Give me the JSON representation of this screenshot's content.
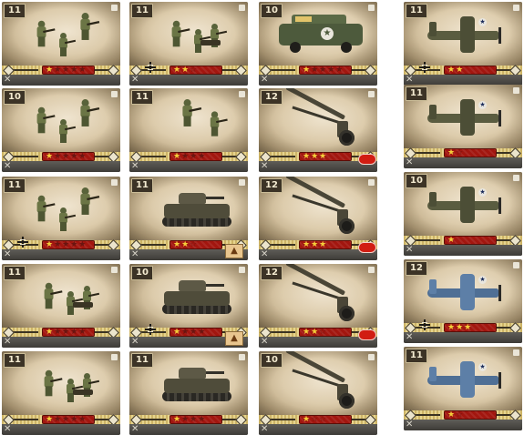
{
  "colors": {
    "ribbon": "#a2160f",
    "star_on": "#f4cf39",
    "star_off": "#6a1510",
    "bar_gold": "#d9c57a",
    "level_bg": "#3c3326",
    "olive_uniform": "#6b7545",
    "navy_plane": "#4f6f95"
  },
  "columns": [
    {
      "cards": [
        {
          "level": "11",
          "unit": "infantry-squad",
          "stars": "★",
          "stars_off": "★★★★",
          "cross": false,
          "badge": "none"
        },
        {
          "level": "10",
          "unit": "infantry-squad",
          "stars": "★",
          "stars_off": "★★★★",
          "cross": false,
          "badge": "none"
        },
        {
          "level": "11",
          "unit": "infantry-squad",
          "stars": "★",
          "stars_off": "★★★★",
          "cross": true,
          "badge": "none"
        },
        {
          "level": "11",
          "unit": "machine-gun-team",
          "stars": "★",
          "stars_off": "★★★★",
          "cross": false,
          "badge": "none"
        },
        {
          "level": "11",
          "unit": "machine-gun-team",
          "stars": "★",
          "stars_off": "★★★★",
          "cross": false,
          "badge": "none"
        }
      ]
    },
    {
      "cards": [
        {
          "level": "11",
          "unit": "machine-gun-team",
          "stars": "★★",
          "stars_off": "☆",
          "cross": true,
          "badge": "none"
        },
        {
          "level": "11",
          "unit": "infantry-pair",
          "stars": "★",
          "stars_off": "★★★",
          "cross": false,
          "badge": "none"
        },
        {
          "level": "11",
          "unit": "light-tank",
          "stars": "★★",
          "stars_off": "☆",
          "cross": false,
          "badge": "triangle"
        },
        {
          "level": "10",
          "unit": "light-tank",
          "stars": "★",
          "stars_off": "★★★",
          "cross": true,
          "badge": "triangle"
        },
        {
          "level": "11",
          "unit": "light-tank",
          "stars": "★",
          "stars_off": "★★★",
          "cross": false,
          "badge": "none"
        }
      ]
    },
    {
      "cards": [
        {
          "level": "10",
          "unit": "armored-car",
          "stars": "★",
          "stars_off": "★★★★",
          "cross": false,
          "badge": "none"
        },
        {
          "level": "12",
          "unit": "howitzer",
          "stars": "★★★",
          "stars_off": "",
          "cross": false,
          "badge": "red"
        },
        {
          "level": "12",
          "unit": "howitzer",
          "stars": "★★★",
          "stars_off": "",
          "cross": false,
          "badge": "red"
        },
        {
          "level": "12",
          "unit": "howitzer",
          "stars": "★★",
          "stars_off": "☆",
          "cross": false,
          "badge": "red"
        },
        {
          "level": "10",
          "unit": "howitzer",
          "stars": "★",
          "stars_off": "☆☆",
          "cross": false,
          "badge": "none"
        }
      ]
    },
    {
      "cards": [
        {
          "level": "11",
          "unit": "fighter-olive",
          "stars": "★★",
          "stars_off": "",
          "cross": true,
          "badge": "none"
        },
        {
          "level": "11",
          "unit": "fighter-olive",
          "stars": "★",
          "stars_off": "☆",
          "cross": false,
          "badge": "none"
        },
        {
          "level": "10",
          "unit": "fighter-olive",
          "stars": "★",
          "stars_off": "",
          "cross": false,
          "badge": "none"
        },
        {
          "level": "12",
          "unit": "dive-bomber-navy",
          "stars": "★★★",
          "stars_off": "",
          "cross": true,
          "badge": "none"
        },
        {
          "level": "11",
          "unit": "dive-bomber-navy",
          "stars": "★",
          "stars_off": "☆",
          "cross": false,
          "badge": "none"
        }
      ]
    }
  ]
}
